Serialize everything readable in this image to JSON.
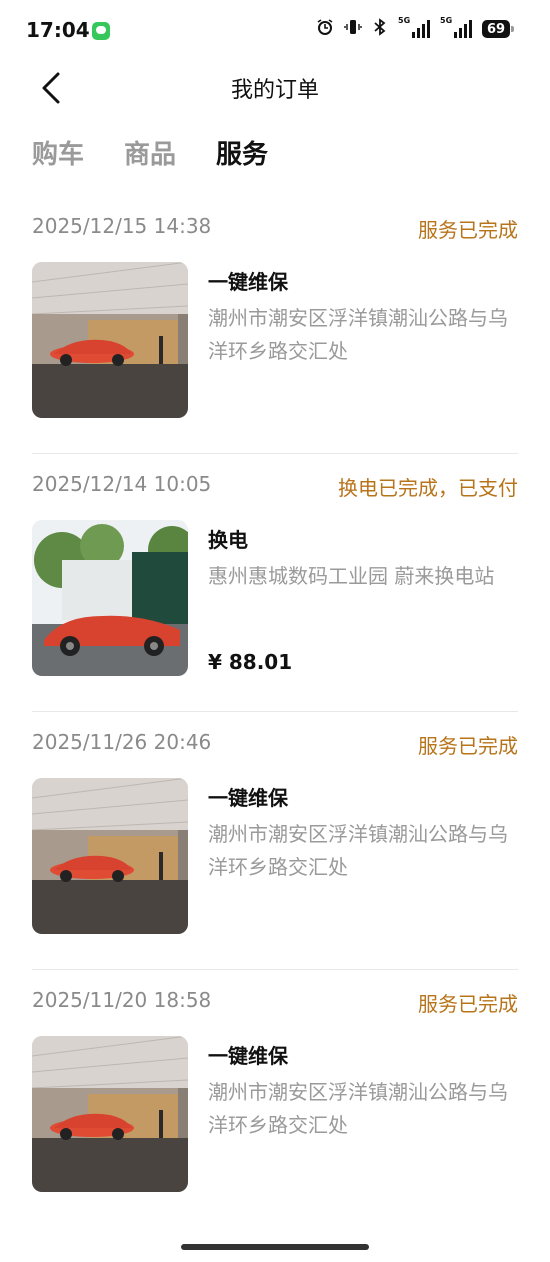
{
  "status_bar": {
    "time": "17:04",
    "signal_1": "5G",
    "signal_2": "5G",
    "battery": "69",
    "icons": [
      "message-icon",
      "alarm-icon",
      "vibrate-icon",
      "bluetooth-icon",
      "signal-icon",
      "battery-icon"
    ]
  },
  "header": {
    "title": "我的订单",
    "back_icon": "chevron-left-icon"
  },
  "tabs": [
    {
      "label": "购车",
      "active": false
    },
    {
      "label": "商品",
      "active": false
    },
    {
      "label": "服务",
      "active": true
    }
  ],
  "orders": [
    {
      "date": "2025/12/15 14:38",
      "status": "服务已完成",
      "title": "一键维保",
      "address": "潮州市潮安区浮洋镇潮汕公路与乌洋环乡路交汇处",
      "price": ""
    },
    {
      "date": "2025/12/14 10:05",
      "status": "换电已完成，已支付",
      "title": "换电",
      "address": "惠州惠城数码工业园 蔚来换电站",
      "price": "¥ 88.01"
    },
    {
      "date": "2025/11/26 20:46",
      "status": "服务已完成",
      "title": "一键维保",
      "address": "潮州市潮安区浮洋镇潮汕公路与乌洋环乡路交汇处",
      "price": ""
    },
    {
      "date": "2025/11/20 18:58",
      "status": "服务已完成",
      "title": "一键维保",
      "address": "潮州市潮安区浮洋镇潮汕公路与乌洋环乡路交汇处",
      "price": ""
    }
  ],
  "colors": {
    "status_accent": "#b8741a",
    "muted_text": "#9a9a9a",
    "car_red": "#d8432f"
  }
}
